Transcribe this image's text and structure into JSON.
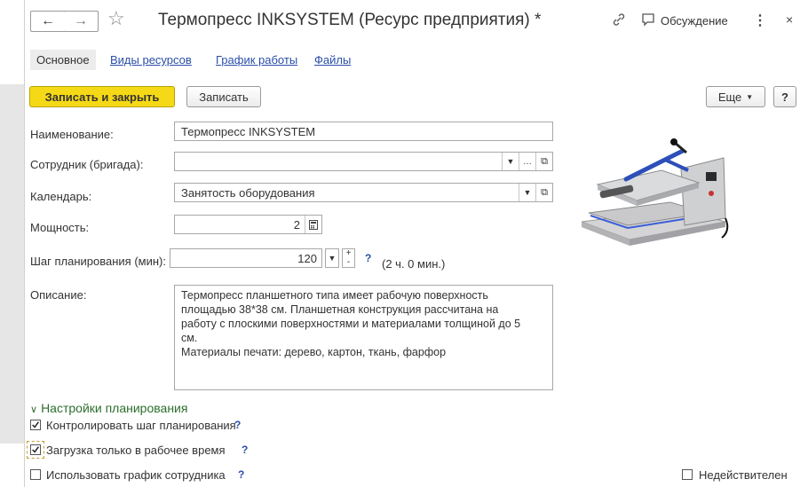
{
  "window": {
    "title": "Термопресс INKSYSTEM (Ресурс предприятия) *",
    "discussion_label": "Обсуждение"
  },
  "tabs": [
    {
      "label": "Основное",
      "active": true
    },
    {
      "label": "Виды ресурсов",
      "active": false
    },
    {
      "label": "График работы",
      "active": false
    },
    {
      "label": "Файлы",
      "active": false
    }
  ],
  "toolbar": {
    "save_close_label": "Записать и закрыть",
    "save_label": "Записать",
    "more_label": "Еще",
    "help_label": "?"
  },
  "form": {
    "name_label": "Наименование:",
    "name_value": "Термопресс INKSYSTEM",
    "employee_label": "Сотрудник (бригада):",
    "employee_value": "",
    "calendar_label": "Календарь:",
    "calendar_value": "Занятость оборудования",
    "power_label": "Мощность:",
    "power_value": "2",
    "step_label": "Шаг планирования (мин):",
    "step_value": "120",
    "step_hint": "(2 ч. 0 мин.)",
    "desc_label": "Описание:",
    "desc_lines": [
      "Термопресс планшетного типа имеет рабочую поверхность",
      "площадью 38*38 см. Планшетная конструкция рассчитана на",
      "работу с плоскими поверхностями и материалами толщиной до 5",
      "см.",
      "Материалы печати: дерево, картон, ткань, фарфор"
    ]
  },
  "planning": {
    "section_label": "Настройки планирования",
    "checkboxes": [
      {
        "label": "Контролировать шаг планирования",
        "checked": true
      },
      {
        "label": "Загрузка только в рабочее время",
        "checked": true
      },
      {
        "label": "Использовать график сотрудника",
        "checked": false
      }
    ],
    "inactive_label": "Недействителен",
    "inactive_checked": false
  },
  "icons": {
    "back": "arrow-left-icon",
    "forward": "arrow-right-icon",
    "star": "star-icon",
    "link": "link-icon",
    "discussion": "speech-bubble-icon",
    "more": "vertical-dots-icon",
    "close": "close-icon",
    "calculator": "calculator-icon",
    "open": "open-form-icon",
    "product_image": "heat-press-image"
  },
  "colors": {
    "primary_button": "#f6d916",
    "link": "#2b4ea8",
    "section": "#2c6e2c"
  }
}
